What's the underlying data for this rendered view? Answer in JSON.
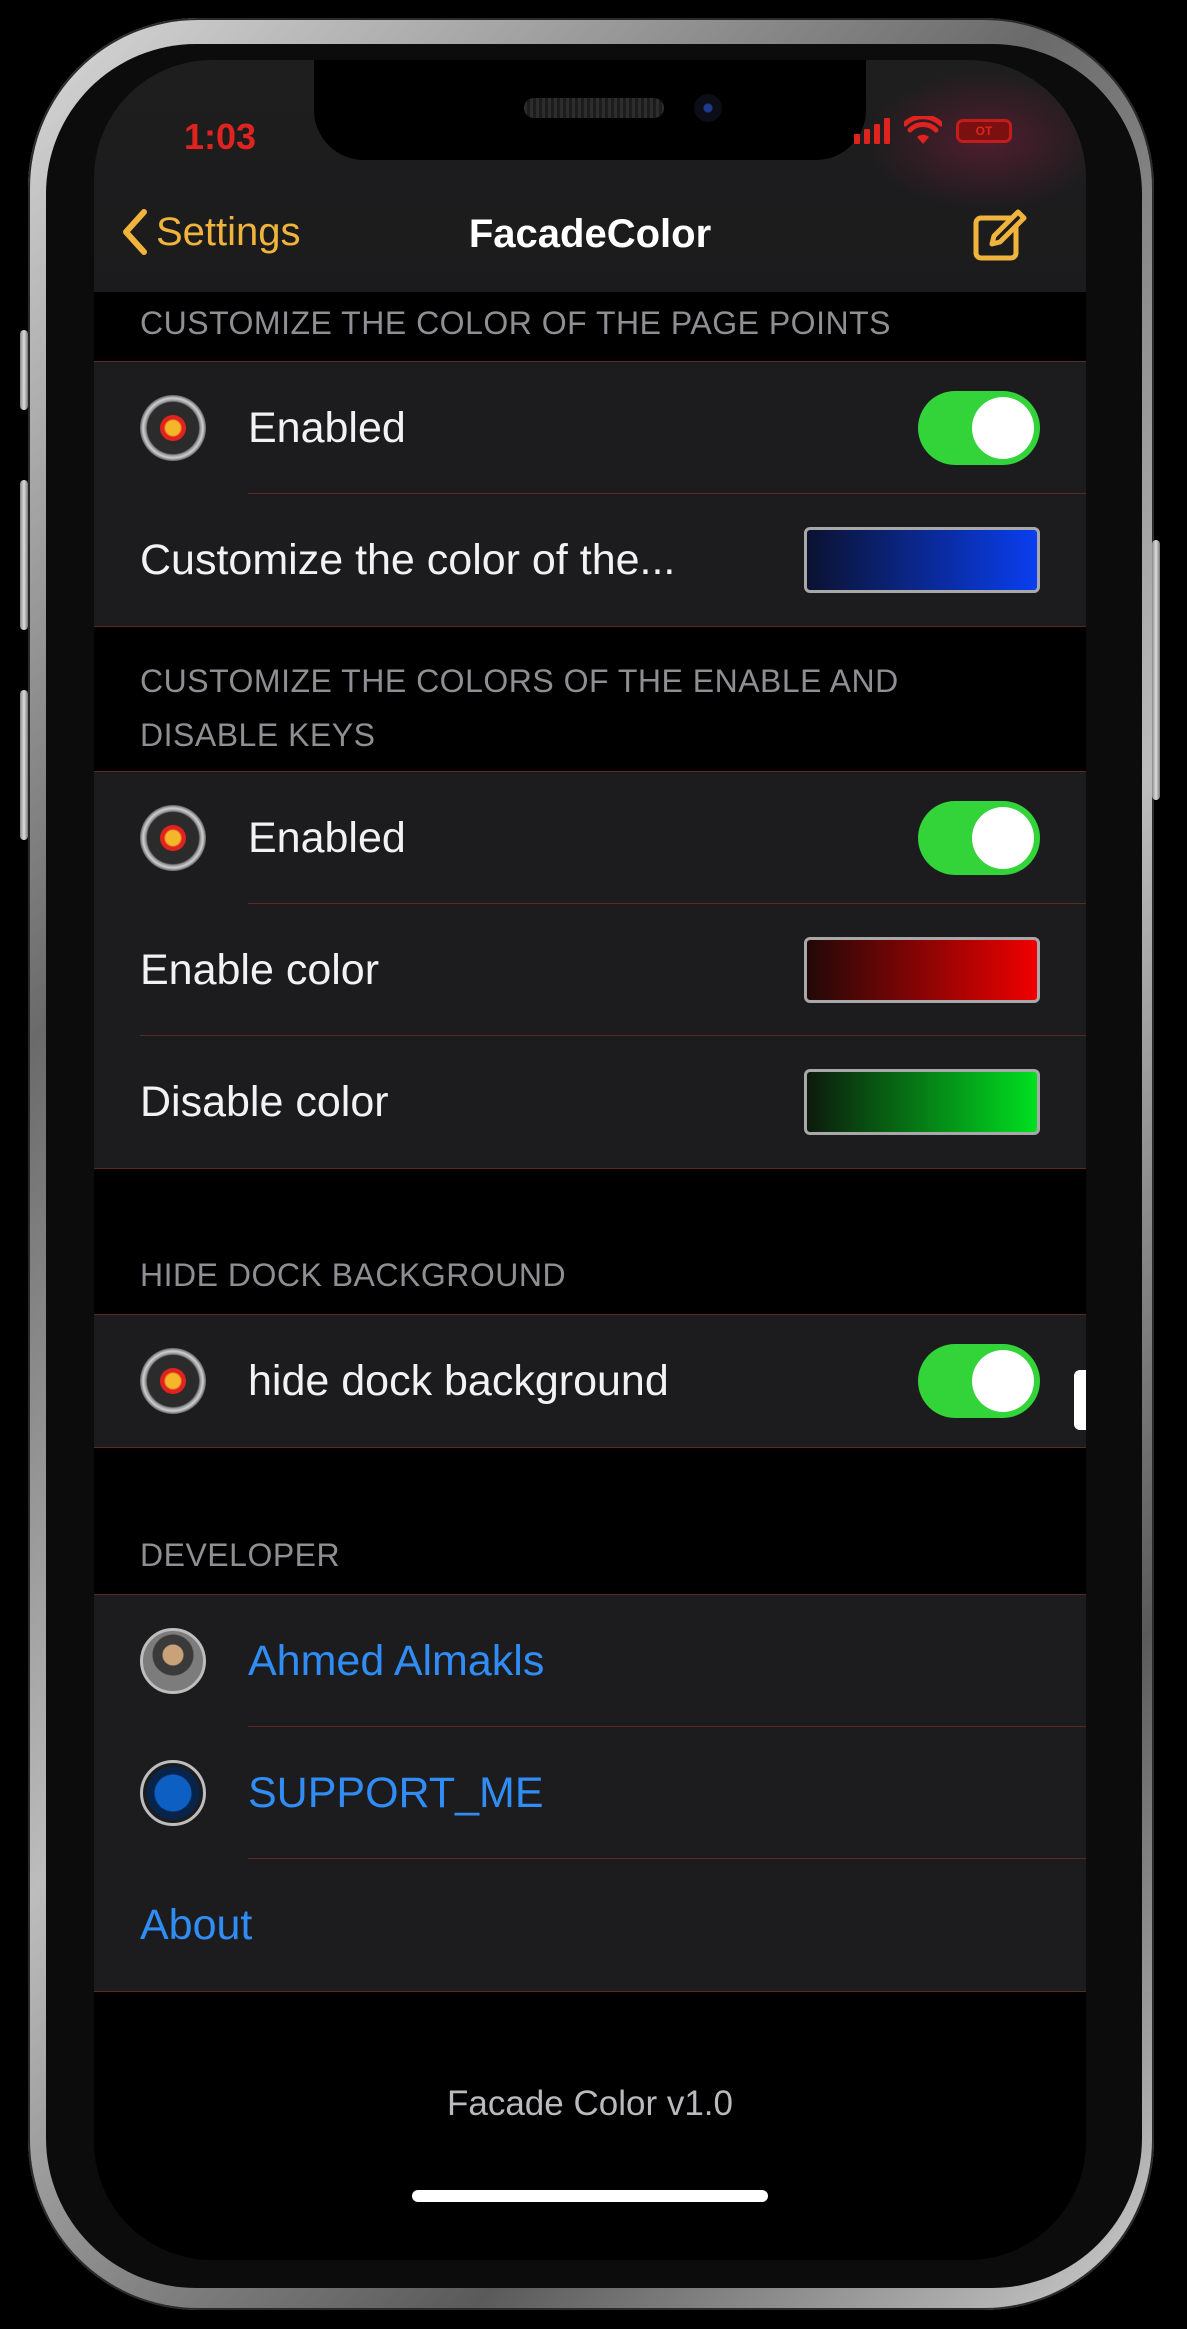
{
  "status_bar": {
    "time": "1:03",
    "battery_label": "OT"
  },
  "nav": {
    "back_label": "Settings",
    "title": "FacadeColor"
  },
  "sections": {
    "page_points": {
      "header": "CUSTOMIZE THE COLOR OF THE PAGE POINTS",
      "enabled_label": "Enabled",
      "enabled": true,
      "color_label": "Customize the color of the...",
      "color": "#0a3ef0"
    },
    "keys": {
      "header_line1": "CUSTOMIZE THE COLORS OF THE ENABLE AND",
      "header_line2": "DISABLE KEYS",
      "enabled_label": "Enabled",
      "enabled": true,
      "enable_color_label": "Enable color",
      "enable_color": "#f00000",
      "disable_color_label": "Disable color",
      "disable_color": "#00e020"
    },
    "dock": {
      "header": "HIDE DOCK BACKGROUND",
      "toggle_label": "hide dock background",
      "enabled": true
    },
    "developer": {
      "header": "DEVELOPER",
      "dev_name": "Ahmed Almakls",
      "support_label": "SUPPORT_ME",
      "about_label": "About"
    }
  },
  "footer": {
    "version_text": "Facade Color v1.0"
  },
  "colors": {
    "accent": "#f0b33c",
    "link": "#2f8df5",
    "toggle_on": "#33d33a",
    "status_red": "#e0231f",
    "separator": "#5a2a22"
  },
  "icons": [
    "chevron-left-icon",
    "compose-icon",
    "power-icon",
    "wifi-icon",
    "signal-icon",
    "battery-icon"
  ]
}
